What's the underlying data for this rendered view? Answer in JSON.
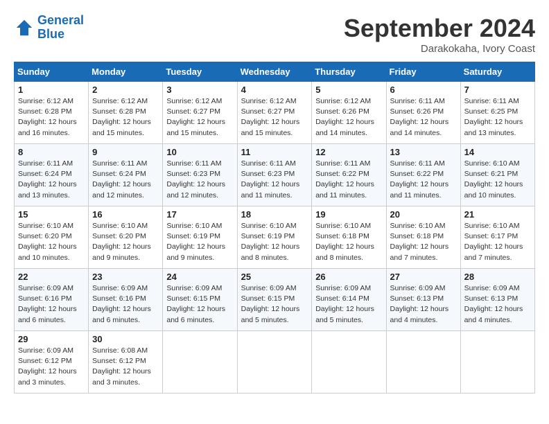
{
  "header": {
    "logo_line1": "General",
    "logo_line2": "Blue",
    "month_title": "September 2024",
    "location": "Darakokaha, Ivory Coast"
  },
  "days_of_week": [
    "Sunday",
    "Monday",
    "Tuesday",
    "Wednesday",
    "Thursday",
    "Friday",
    "Saturday"
  ],
  "weeks": [
    [
      {
        "day": "1",
        "sunrise": "6:12 AM",
        "sunset": "6:28 PM",
        "daylight": "12 hours and 16 minutes."
      },
      {
        "day": "2",
        "sunrise": "6:12 AM",
        "sunset": "6:28 PM",
        "daylight": "12 hours and 15 minutes."
      },
      {
        "day": "3",
        "sunrise": "6:12 AM",
        "sunset": "6:27 PM",
        "daylight": "12 hours and 15 minutes."
      },
      {
        "day": "4",
        "sunrise": "6:12 AM",
        "sunset": "6:27 PM",
        "daylight": "12 hours and 15 minutes."
      },
      {
        "day": "5",
        "sunrise": "6:12 AM",
        "sunset": "6:26 PM",
        "daylight": "12 hours and 14 minutes."
      },
      {
        "day": "6",
        "sunrise": "6:11 AM",
        "sunset": "6:26 PM",
        "daylight": "12 hours and 14 minutes."
      },
      {
        "day": "7",
        "sunrise": "6:11 AM",
        "sunset": "6:25 PM",
        "daylight": "12 hours and 13 minutes."
      }
    ],
    [
      {
        "day": "8",
        "sunrise": "6:11 AM",
        "sunset": "6:24 PM",
        "daylight": "12 hours and 13 minutes."
      },
      {
        "day": "9",
        "sunrise": "6:11 AM",
        "sunset": "6:24 PM",
        "daylight": "12 hours and 12 minutes."
      },
      {
        "day": "10",
        "sunrise": "6:11 AM",
        "sunset": "6:23 PM",
        "daylight": "12 hours and 12 minutes."
      },
      {
        "day": "11",
        "sunrise": "6:11 AM",
        "sunset": "6:23 PM",
        "daylight": "12 hours and 11 minutes."
      },
      {
        "day": "12",
        "sunrise": "6:11 AM",
        "sunset": "6:22 PM",
        "daylight": "12 hours and 11 minutes."
      },
      {
        "day": "13",
        "sunrise": "6:11 AM",
        "sunset": "6:22 PM",
        "daylight": "12 hours and 11 minutes."
      },
      {
        "day": "14",
        "sunrise": "6:10 AM",
        "sunset": "6:21 PM",
        "daylight": "12 hours and 10 minutes."
      }
    ],
    [
      {
        "day": "15",
        "sunrise": "6:10 AM",
        "sunset": "6:20 PM",
        "daylight": "12 hours and 10 minutes."
      },
      {
        "day": "16",
        "sunrise": "6:10 AM",
        "sunset": "6:20 PM",
        "daylight": "12 hours and 9 minutes."
      },
      {
        "day": "17",
        "sunrise": "6:10 AM",
        "sunset": "6:19 PM",
        "daylight": "12 hours and 9 minutes."
      },
      {
        "day": "18",
        "sunrise": "6:10 AM",
        "sunset": "6:19 PM",
        "daylight": "12 hours and 8 minutes."
      },
      {
        "day": "19",
        "sunrise": "6:10 AM",
        "sunset": "6:18 PM",
        "daylight": "12 hours and 8 minutes."
      },
      {
        "day": "20",
        "sunrise": "6:10 AM",
        "sunset": "6:18 PM",
        "daylight": "12 hours and 7 minutes."
      },
      {
        "day": "21",
        "sunrise": "6:10 AM",
        "sunset": "6:17 PM",
        "daylight": "12 hours and 7 minutes."
      }
    ],
    [
      {
        "day": "22",
        "sunrise": "6:09 AM",
        "sunset": "6:16 PM",
        "daylight": "12 hours and 6 minutes."
      },
      {
        "day": "23",
        "sunrise": "6:09 AM",
        "sunset": "6:16 PM",
        "daylight": "12 hours and 6 minutes."
      },
      {
        "day": "24",
        "sunrise": "6:09 AM",
        "sunset": "6:15 PM",
        "daylight": "12 hours and 6 minutes."
      },
      {
        "day": "25",
        "sunrise": "6:09 AM",
        "sunset": "6:15 PM",
        "daylight": "12 hours and 5 minutes."
      },
      {
        "day": "26",
        "sunrise": "6:09 AM",
        "sunset": "6:14 PM",
        "daylight": "12 hours and 5 minutes."
      },
      {
        "day": "27",
        "sunrise": "6:09 AM",
        "sunset": "6:13 PM",
        "daylight": "12 hours and 4 minutes."
      },
      {
        "day": "28",
        "sunrise": "6:09 AM",
        "sunset": "6:13 PM",
        "daylight": "12 hours and 4 minutes."
      }
    ],
    [
      {
        "day": "29",
        "sunrise": "6:09 AM",
        "sunset": "6:12 PM",
        "daylight": "12 hours and 3 minutes."
      },
      {
        "day": "30",
        "sunrise": "6:08 AM",
        "sunset": "6:12 PM",
        "daylight": "12 hours and 3 minutes."
      },
      null,
      null,
      null,
      null,
      null
    ]
  ]
}
